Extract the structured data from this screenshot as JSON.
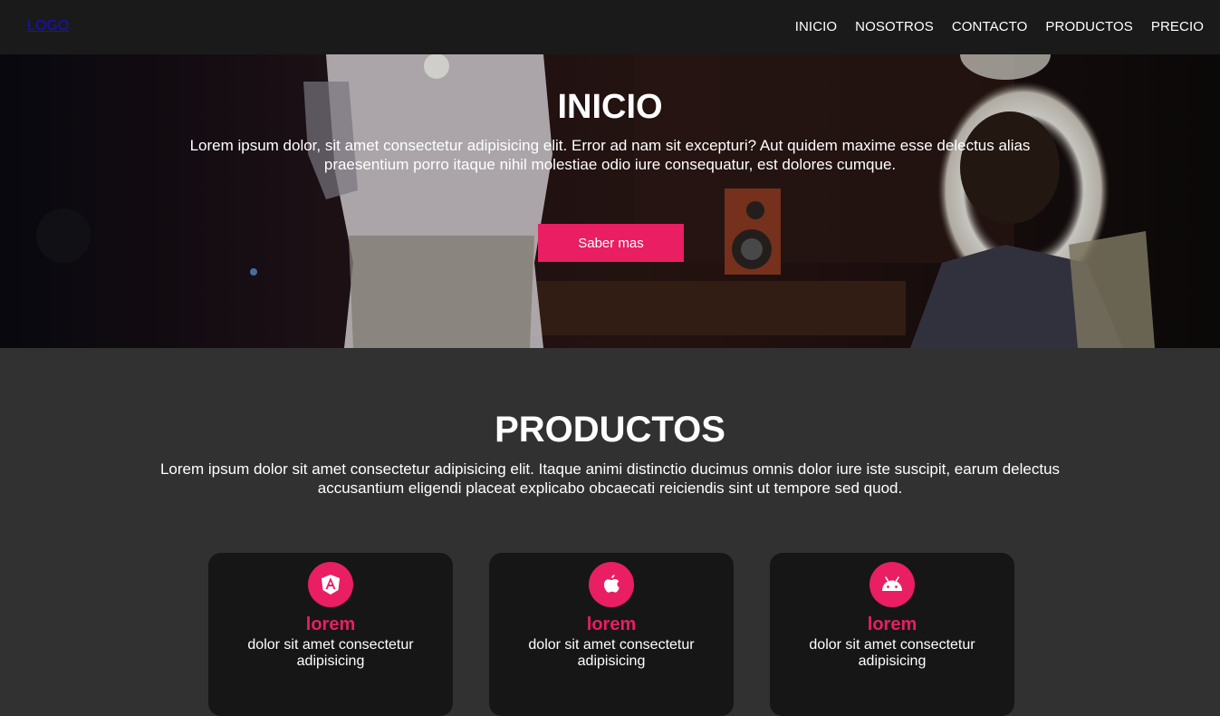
{
  "navbar": {
    "logo": "LOGO",
    "links": [
      "INICIO",
      "NOSOTROS",
      "CONTACTO",
      "PRODUCTOS",
      "PRECIO"
    ]
  },
  "hero": {
    "title": "INICIO",
    "text": "Lorem ipsum dolor, sit amet consectetur adipisicing elit. Error ad nam sit excepturi? Aut quidem maxime esse delectus alias praesentium porro itaque nihil molestiae odio iure consequatur, est dolores cumque.",
    "button_label": "Saber mas"
  },
  "products": {
    "title": "PRODUCTOS",
    "text": "Lorem ipsum dolor sit amet consectetur adipisicing elit. Itaque animi distinctio ducimus omnis dolor iure iste suscipit, earum delectus accusantium eligendi placeat explicabo obcaecati reiciendis sint ut tempore sed quod.",
    "cards": [
      {
        "icon": "angular-icon",
        "title": "lorem",
        "text": "dolor sit amet consectetur adipisicing"
      },
      {
        "icon": "apple-icon",
        "title": "lorem",
        "text": "dolor sit amet consectetur adipisicing"
      },
      {
        "icon": "android-icon",
        "title": "lorem",
        "text": "dolor sit amet consectetur adipisicing"
      }
    ]
  },
  "colors": {
    "accent": "#e91e63",
    "navbar_bg": "#1a1a1a",
    "section_bg": "#313131",
    "card_bg": "#161616"
  }
}
